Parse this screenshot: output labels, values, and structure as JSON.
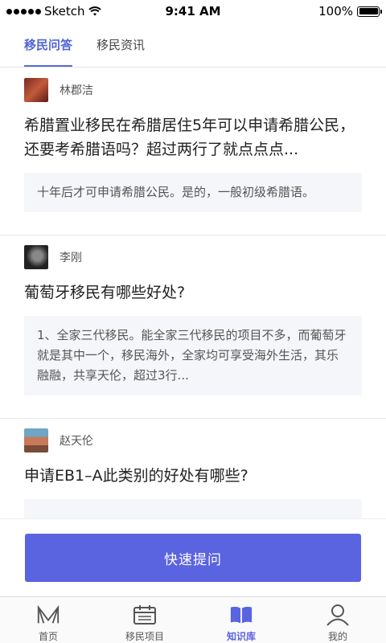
{
  "status_bar": {
    "carrier": "Sketch",
    "time": "9:41 AM",
    "battery": "100%"
  },
  "tabs": [
    {
      "label": "移民问答",
      "active": true
    },
    {
      "label": "移民资讯",
      "active": false
    }
  ],
  "posts": [
    {
      "author": "林郡洁",
      "question": "希腊置业移民在希腊居住5年可以申请希腊公民，还要考希腊语吗？超过两行了就点点点...",
      "answer": "十年后才可申请希腊公民。是的，一般初级希腊语。"
    },
    {
      "author": "李刚",
      "question": "葡萄牙移民有哪些好处?",
      "answer": "1、全家三代移民。能全家三代移民的项目不多，而葡萄牙就是其中一个，移民海外，全家均可享受海外生活，其乐融融，共享天伦，超过3行..."
    },
    {
      "author": "赵天伦",
      "question": "申请EB1–A此类别的好处有哪些?",
      "answer": ""
    }
  ],
  "action": {
    "button_label": "快速提问"
  },
  "bottom_nav": [
    {
      "label": "首页",
      "icon": "home-logo-icon",
      "active": false
    },
    {
      "label": "移民项目",
      "icon": "calendar-icon",
      "active": false
    },
    {
      "label": "知识库",
      "icon": "book-icon",
      "active": true
    },
    {
      "label": "我的",
      "icon": "user-icon",
      "active": false
    }
  ],
  "colors": {
    "accent": "#5a63e0",
    "answer_bg": "#f5f6f9"
  }
}
